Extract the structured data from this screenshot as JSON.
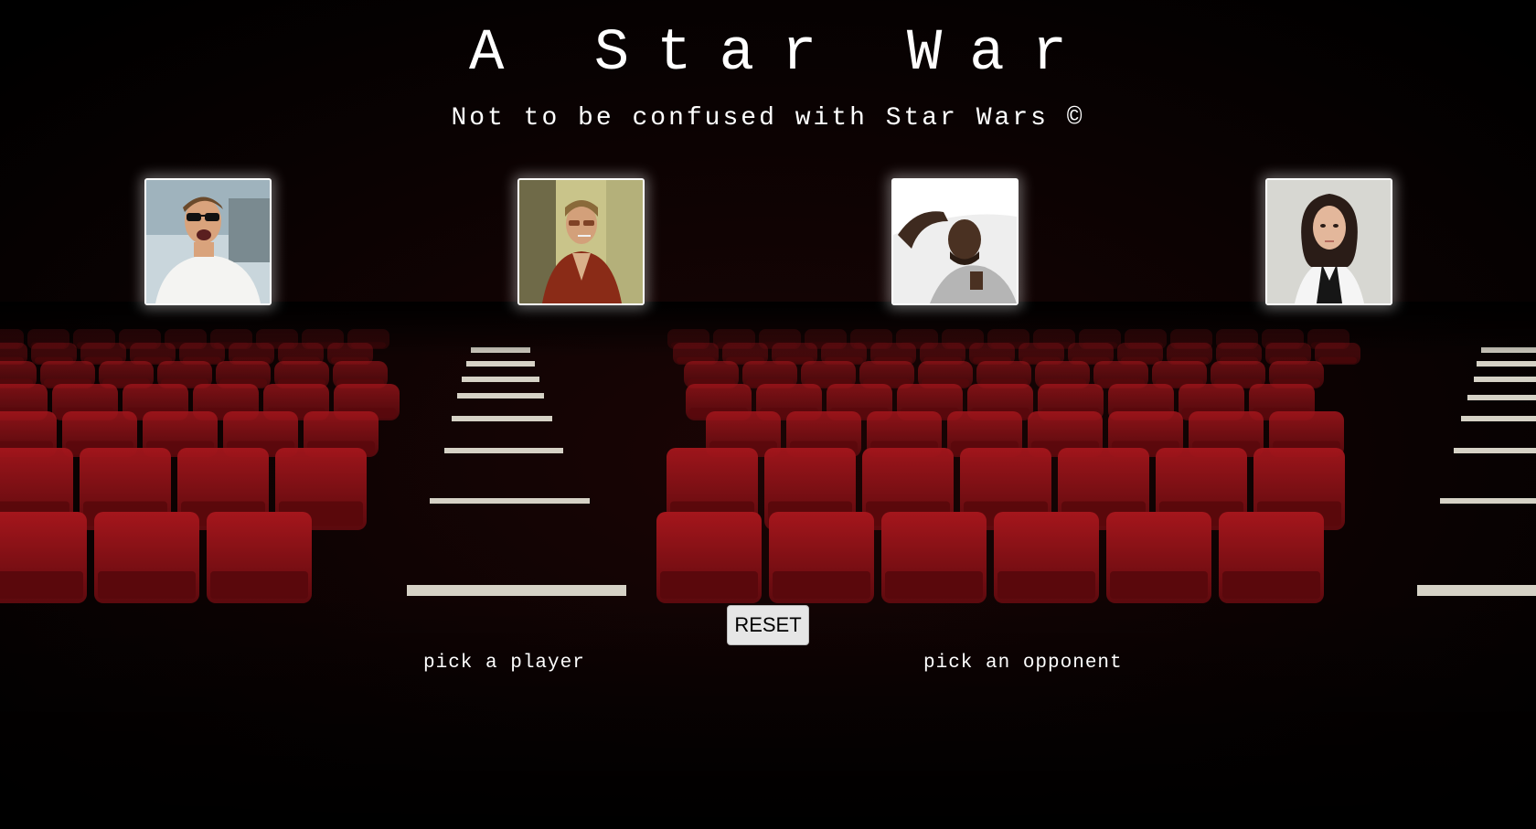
{
  "header": {
    "title": "A Star War",
    "subtitle": "Not to be confused with Star Wars ©"
  },
  "characters": [
    {
      "icon": "man-sunglasses-portrait-icon"
    },
    {
      "icon": "man-red-jacket-portrait-icon"
    },
    {
      "icon": "man-lying-bed-portrait-icon"
    },
    {
      "icon": "woman-white-blouse-portrait-icon"
    }
  ],
  "controls": {
    "reset_label": "RESET"
  },
  "status": {
    "player_prompt": "pick a player",
    "opponent_prompt": "pick an opponent"
  },
  "colors": {
    "background": "#000000",
    "seat_red": "#8b0f14",
    "text": "#ffffff",
    "button_bg": "#e6e6e6"
  }
}
